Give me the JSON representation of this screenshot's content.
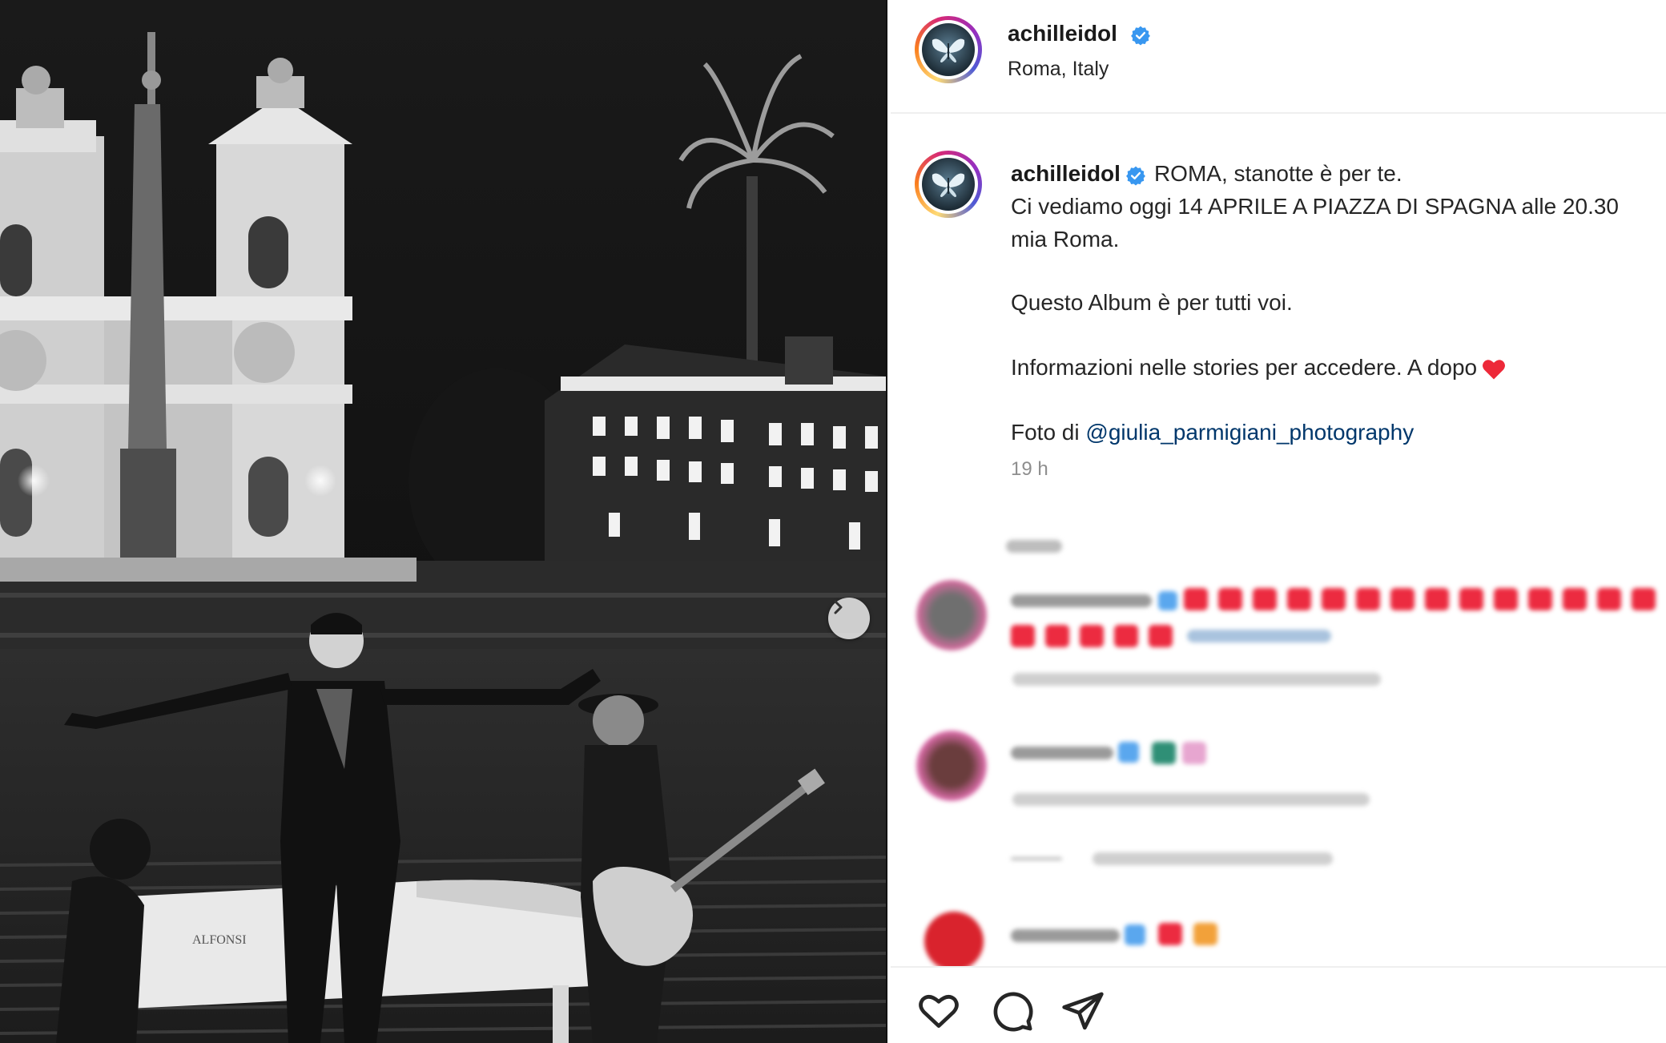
{
  "post": {
    "author": "achilleidol",
    "location": "Roma, Italy",
    "caption": {
      "author": "achilleidol",
      "line1": "ROMA, stanotte è per te.",
      "line2": "Ci vediamo oggi 14 APRILE A PIAZZA DI SPAGNA alle 20.30",
      "line3": "mia Roma.",
      "line4": "Questo Album è per tutti voi.",
      "line5": "Informazioni nelle stories per accedere. A dopo",
      "photo_credit_prefix": "Foto di",
      "photo_credit_handle": "@giulia_parmigiani_photography",
      "time": "19 h"
    },
    "photo_sign_text": "ALFONSI"
  },
  "icons": {
    "verified": "verified-badge-icon",
    "next": "chevron-right-icon",
    "like": "heart-outline-icon",
    "comment": "comment-bubble-icon",
    "share": "share-send-icon",
    "heart_emoji": "red-heart-emoji"
  },
  "colors": {
    "verified_blue": "#3897f0",
    "link": "#00376b",
    "heart_red": "#ed2939",
    "muted": "#8e8e8e"
  }
}
